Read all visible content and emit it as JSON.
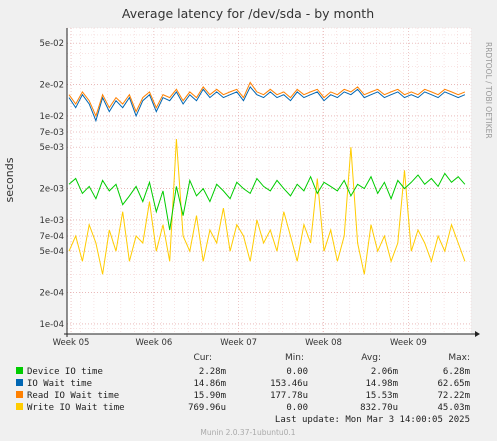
{
  "chart_data": {
    "type": "line",
    "title": "Average latency for /dev/sda - by month",
    "ylabel": "seconds",
    "y_scale": "log",
    "ylim": [
      8e-05,
      0.07
    ],
    "grid": true,
    "watermark": "RRDTOOL / TOBI OETIKER",
    "x_ticks": [
      "Week 05",
      "Week 06",
      "Week 07",
      "Week 08",
      "Week 09"
    ],
    "y_ticks": [
      {
        "value": 0.05,
        "label": "5e-02"
      },
      {
        "value": 0.02,
        "label": "2e-02"
      },
      {
        "value": 0.01,
        "label": "1e-02"
      },
      {
        "value": 0.007,
        "label": "7e-03"
      },
      {
        "value": 0.005,
        "label": "5e-03"
      },
      {
        "value": 0.002,
        "label": "2e-03"
      },
      {
        "value": 0.001,
        "label": "1e-03"
      },
      {
        "value": 0.0007,
        "label": "7e-04"
      },
      {
        "value": 0.0005,
        "label": "5e-04"
      },
      {
        "value": 0.0002,
        "label": "2e-04"
      },
      {
        "value": 0.0001,
        "label": "1e-04"
      }
    ],
    "series": [
      {
        "name": "Device IO time",
        "color": "#00cc00",
        "values": [
          0.0022,
          0.0025,
          0.0018,
          0.0021,
          0.0016,
          0.0024,
          0.0019,
          0.0022,
          0.0014,
          0.0017,
          0.0021,
          0.0015,
          0.0023,
          0.0012,
          0.0019,
          0.0008,
          0.0021,
          0.0011,
          0.0024,
          0.0017,
          0.002,
          0.0015,
          0.0022,
          0.0019,
          0.0016,
          0.0023,
          0.002,
          0.0018,
          0.0025,
          0.0021,
          0.0019,
          0.0024,
          0.002,
          0.0017,
          0.0022,
          0.0019,
          0.0026,
          0.0018,
          0.0023,
          0.0021,
          0.0019,
          0.0024,
          0.0017,
          0.0022,
          0.002,
          0.0026,
          0.0018,
          0.0023,
          0.0016,
          0.0024,
          0.002,
          0.0023,
          0.0027,
          0.0022,
          0.0025,
          0.0021,
          0.0028,
          0.0023,
          0.0026,
          0.0022
        ]
      },
      {
        "name": "IO Wait time",
        "color": "#0066b3",
        "values": [
          0.015,
          0.012,
          0.016,
          0.013,
          0.009,
          0.015,
          0.011,
          0.014,
          0.012,
          0.015,
          0.01,
          0.014,
          0.016,
          0.011,
          0.015,
          0.014,
          0.017,
          0.013,
          0.016,
          0.014,
          0.018,
          0.015,
          0.017,
          0.015,
          0.016,
          0.017,
          0.014,
          0.019,
          0.016,
          0.015,
          0.017,
          0.015,
          0.016,
          0.014,
          0.017,
          0.015,
          0.016,
          0.017,
          0.014,
          0.016,
          0.015,
          0.017,
          0.016,
          0.018,
          0.015,
          0.016,
          0.017,
          0.015,
          0.016,
          0.017,
          0.015,
          0.016,
          0.015,
          0.017,
          0.016,
          0.015,
          0.017,
          0.016,
          0.015,
          0.016
        ]
      },
      {
        "name": "Read IO Wait time",
        "color": "#ff8000",
        "values": [
          0.016,
          0.013,
          0.017,
          0.014,
          0.01,
          0.016,
          0.012,
          0.015,
          0.013,
          0.016,
          0.011,
          0.015,
          0.017,
          0.012,
          0.016,
          0.015,
          0.018,
          0.014,
          0.017,
          0.015,
          0.019,
          0.016,
          0.018,
          0.016,
          0.017,
          0.018,
          0.015,
          0.021,
          0.017,
          0.016,
          0.018,
          0.016,
          0.017,
          0.015,
          0.018,
          0.016,
          0.017,
          0.018,
          0.015,
          0.017,
          0.016,
          0.018,
          0.017,
          0.019,
          0.016,
          0.017,
          0.018,
          0.016,
          0.017,
          0.018,
          0.016,
          0.017,
          0.016,
          0.018,
          0.017,
          0.016,
          0.018,
          0.017,
          0.016,
          0.017
        ]
      },
      {
        "name": "Write IO Wait time",
        "color": "#ffcc00",
        "values": [
          0.0005,
          0.0007,
          0.0004,
          0.0009,
          0.0006,
          0.0003,
          0.0008,
          0.0005,
          0.0012,
          0.0004,
          0.0007,
          0.0006,
          0.0015,
          0.0005,
          0.0009,
          0.0004,
          0.006,
          0.0007,
          0.0005,
          0.0011,
          0.0004,
          0.0008,
          0.0006,
          0.0013,
          0.0005,
          0.0009,
          0.0007,
          0.0004,
          0.001,
          0.0006,
          0.0008,
          0.0005,
          0.0012,
          0.0007,
          0.0004,
          0.0009,
          0.0006,
          0.0025,
          0.0005,
          0.0008,
          0.0004,
          0.0007,
          0.005,
          0.0006,
          0.0003,
          0.0009,
          0.0005,
          0.0007,
          0.0004,
          0.0006,
          0.003,
          0.0005,
          0.0008,
          0.0006,
          0.0004,
          0.0007,
          0.0005,
          0.0009,
          0.0006,
          0.0004
        ]
      }
    ]
  },
  "legend": {
    "headers": {
      "cur": "Cur:",
      "min": "Min:",
      "avg": "Avg:",
      "max": "Max:"
    },
    "rows": [
      {
        "name": "Device IO time",
        "color": "#00cc00",
        "cur": "2.28m",
        "min": "0.00",
        "avg": "2.06m",
        "max": "6.28m"
      },
      {
        "name": "IO Wait time",
        "color": "#0066b3",
        "cur": "14.86m",
        "min": "153.46u",
        "avg": "14.98m",
        "max": "62.65m"
      },
      {
        "name": "Read IO Wait time",
        "color": "#ff8000",
        "cur": "15.90m",
        "min": "177.78u",
        "avg": "15.53m",
        "max": "72.22m"
      },
      {
        "name": "Write IO Wait time",
        "color": "#ffcc00",
        "cur": "769.96u",
        "min": "0.00",
        "avg": "832.70u",
        "max": "45.03m"
      }
    ]
  },
  "last_update": "Last update: Mon Mar  3 14:00:05 2025",
  "footer": "Munin 2.0.37-1ubuntu0.1"
}
